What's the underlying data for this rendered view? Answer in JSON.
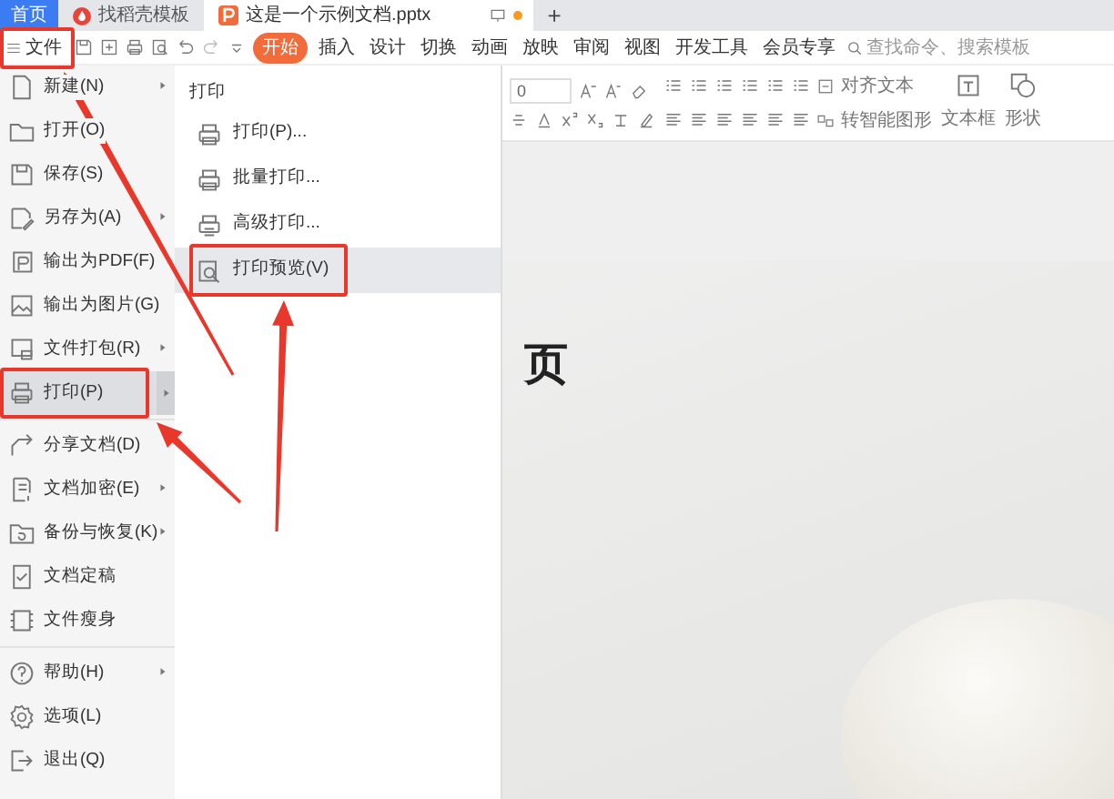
{
  "browser_tabs": [
    {
      "label": "首页",
      "kind": "home",
      "selected": false
    },
    {
      "label": "找稻壳模板",
      "kind": "template",
      "selected": false
    },
    {
      "label": "这是一个示例文档.pptx",
      "kind": "document",
      "selected": true
    }
  ],
  "new_tab_button": {
    "label": "+"
  },
  "file_button": {
    "label": "文件",
    "annotated": true
  },
  "ribbon_tabs": [
    {
      "label": "开始",
      "selected": true
    },
    {
      "label": "插入",
      "selected": false
    },
    {
      "label": "设计",
      "selected": false
    },
    {
      "label": "切换",
      "selected": false
    },
    {
      "label": "动画",
      "selected": false
    },
    {
      "label": "放映",
      "selected": false
    },
    {
      "label": "审阅",
      "selected": false
    },
    {
      "label": "视图",
      "selected": false
    },
    {
      "label": "开发工具",
      "selected": false
    },
    {
      "label": "会员专享",
      "selected": false
    }
  ],
  "search": {
    "placeholder": "查找命令、搜索模板"
  },
  "ribbon": {
    "font_size": "0",
    "align_text": "对齐文本",
    "smart_art": "转智能图形",
    "text_box": "文本框",
    "shape": "形状"
  },
  "file_menu": {
    "groups": [
      [
        {
          "label": "新建(N)",
          "has_submenu": true,
          "selected": false,
          "annotated": false
        },
        {
          "label": "打开(O)",
          "has_submenu": false,
          "selected": false,
          "annotated": false
        },
        {
          "label": "保存(S)",
          "has_submenu": false,
          "selected": false,
          "annotated": false
        },
        {
          "label": "另存为(A)",
          "has_submenu": true,
          "selected": false,
          "annotated": false
        },
        {
          "label": "输出为PDF(F)",
          "has_submenu": false,
          "selected": false,
          "annotated": false
        },
        {
          "label": "输出为图片(G)",
          "has_submenu": false,
          "selected": false,
          "annotated": false
        },
        {
          "label": "文件打包(R)",
          "has_submenu": true,
          "selected": false,
          "annotated": false
        },
        {
          "label": "打印(P)",
          "has_submenu": true,
          "selected": true,
          "annotated": true
        }
      ],
      [
        {
          "label": "分享文档(D)",
          "has_submenu": false,
          "selected": false,
          "annotated": false
        },
        {
          "label": "文档加密(E)",
          "has_submenu": true,
          "selected": false,
          "annotated": false
        },
        {
          "label": "备份与恢复(K)",
          "has_submenu": true,
          "selected": false,
          "annotated": false
        },
        {
          "label": "文档定稿",
          "has_submenu": false,
          "selected": false,
          "annotated": false
        },
        {
          "label": "文件瘦身",
          "has_submenu": false,
          "selected": false,
          "annotated": false
        }
      ],
      [
        {
          "label": "帮助(H)",
          "has_submenu": true,
          "selected": false,
          "annotated": false
        },
        {
          "label": "选项(L)",
          "has_submenu": false,
          "selected": false,
          "annotated": false
        },
        {
          "label": "退出(Q)",
          "has_submenu": false,
          "selected": false,
          "annotated": false
        }
      ]
    ]
  },
  "submenu": {
    "title": "打印",
    "items": [
      {
        "label": "打印(P)...",
        "selected": false,
        "annotated": false
      },
      {
        "label": "批量打印...",
        "selected": false,
        "annotated": false
      },
      {
        "label": "高级打印...",
        "selected": false,
        "annotated": false
      },
      {
        "label": "打印预览(V)",
        "selected": true,
        "annotated": true
      }
    ]
  },
  "slide": {
    "title": "页"
  }
}
